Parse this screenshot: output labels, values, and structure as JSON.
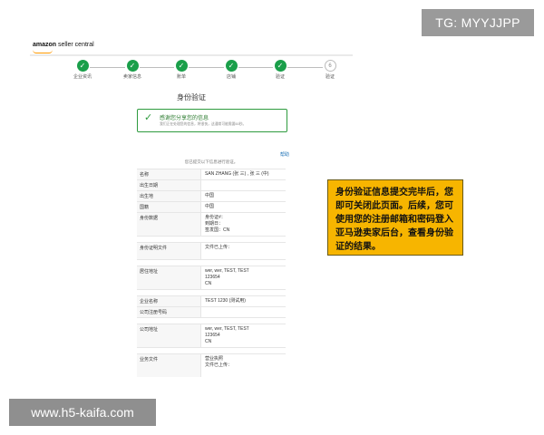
{
  "overlay": {
    "tg_label": "TG: MYYJJPP",
    "site_label": "www.h5-kaifa.com"
  },
  "header": {
    "logo_text_bold": "amazon",
    "logo_text": " seller central"
  },
  "stepper": {
    "steps": [
      {
        "label": "企业资讯",
        "state": "done",
        "marker": "✓"
      },
      {
        "label": "卖家信息",
        "state": "done",
        "marker": "✓"
      },
      {
        "label": "账单",
        "state": "done",
        "marker": "✓"
      },
      {
        "label": "店铺",
        "state": "done",
        "marker": "✓"
      },
      {
        "label": "验证",
        "state": "done",
        "marker": "✓"
      },
      {
        "label": "验证",
        "state": "todo",
        "marker": "6"
      }
    ]
  },
  "page": {
    "title": "身份验证",
    "success_title": "感谢您分享您的信息",
    "success_subtitle": "我们正在处理您的信息，将很快，这通常可能需要60秒。",
    "help_link": "帮助",
    "review_note": "您已提交以下信息进行验证。"
  },
  "info_rows": [
    {
      "type": "row",
      "key": "名称",
      "value": "SAN ZHANG (张 三) , 张 三 (中)"
    },
    {
      "type": "row",
      "key": "出生日期",
      "value": ""
    },
    {
      "type": "row",
      "key": "出生地",
      "value": "中国"
    },
    {
      "type": "row",
      "key": "国籍",
      "value": "中国"
    },
    {
      "type": "row",
      "key": "身份数据",
      "value": "身份证#：\n到期日：\n签发国：CN"
    },
    {
      "type": "gap"
    },
    {
      "type": "row",
      "key": "身份证明文件",
      "value": "文件已上传：\n\n"
    },
    {
      "type": "gap"
    },
    {
      "type": "row",
      "key": "居住地址",
      "value": "wer, wer, TEST, TEST\n123654\nCN"
    },
    {
      "type": "gap"
    },
    {
      "type": "row",
      "key": "企业名称",
      "value": "TEST 1230 (测试用)"
    },
    {
      "type": "row",
      "key": "公司注册号码",
      "value": ""
    },
    {
      "type": "gap"
    },
    {
      "type": "row",
      "key": "公司地址",
      "value": "wer, wer, TEST, TEST\n123654\nCN"
    },
    {
      "type": "gap"
    },
    {
      "type": "row",
      "key": "业务文件",
      "value": "营业执照\n文件已上传：\n\n"
    }
  ],
  "callout": {
    "text": "身份验证信息提交完毕后，您即可关闭此页面。后续，您可使用您的注册邮箱和密码登入亚马逊卖家后台，查看身份验证的结果。"
  },
  "colors": {
    "accent_green": "#1a9f4a",
    "callout_yellow": "#f7b500",
    "link_blue": "#1a6fb5"
  }
}
